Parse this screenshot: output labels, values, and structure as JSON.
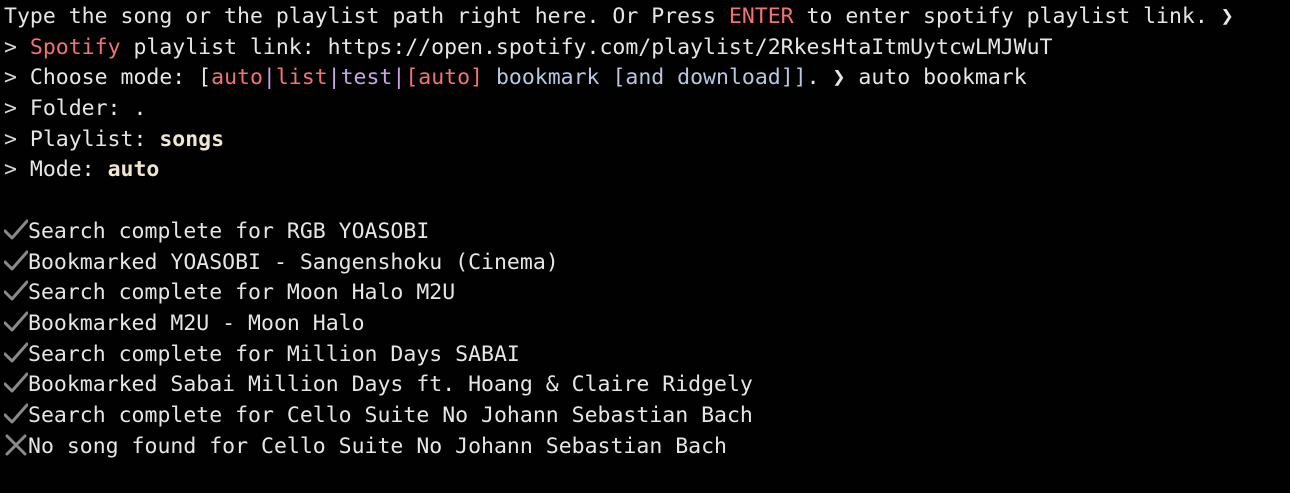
{
  "header": {
    "text_before": "Type the song or the playlist path right here. Or Press ",
    "enter_word": "ENTER",
    "text_after": " to enter spotify playlist link. ❯"
  },
  "prompts": {
    "gt": ">",
    "spotify_word": "Spotify",
    "spotify_rest": " playlist link: https://open.spotify.com/playlist/2RkesHtaItmUytcwLMJWuT",
    "mode_label": " Choose mode: [",
    "opt_auto": "auto",
    "pipe1": "|",
    "opt_list": "list",
    "pipe2": "|",
    "opt_test": "test",
    "pipe3": "|",
    "opt_auto_bracket": "[auto]",
    "opt_bookmark": " bookmark [and download]]",
    "mode_arrow": ". ❯ auto bookmark",
    "folder_label": " Folder: .",
    "playlist_label": " Playlist: ",
    "playlist_value": "songs",
    "mode_sel_label": " Mode: ",
    "mode_sel_value": "auto"
  },
  "log": [
    {
      "status": "success",
      "icon": "check-icon",
      "text": "Search complete for RGB YOASOBI"
    },
    {
      "status": "success",
      "icon": "check-icon",
      "text": "Bookmarked YOASOBI - Sangenshoku (Cinema)"
    },
    {
      "status": "success",
      "icon": "check-icon",
      "text": "Search complete for Moon Halo M2U"
    },
    {
      "status": "success",
      "icon": "check-icon",
      "text": "Bookmarked M2U - Moon Halo"
    },
    {
      "status": "success",
      "icon": "check-icon",
      "text": "Search complete for Million Days SABAI"
    },
    {
      "status": "success",
      "icon": "check-icon",
      "text": "Bookmarked Sabai Million Days ft. Hoang & Claire Ridgely"
    },
    {
      "status": "success",
      "icon": "check-icon",
      "text": "Search complete for Cello Suite No Johann Sebastian Bach"
    },
    {
      "status": "fail",
      "icon": "cross-icon",
      "text": "No song found for Cello Suite No Johann Sebastian Bach"
    }
  ],
  "colors": {
    "background": "#010101",
    "text": "#e6e6e6",
    "accent_red": "#f47272",
    "accent_blue": "#b8c7e0",
    "accent_purple": "#c7a6e8",
    "icon_gray": "#8a8a8a"
  }
}
